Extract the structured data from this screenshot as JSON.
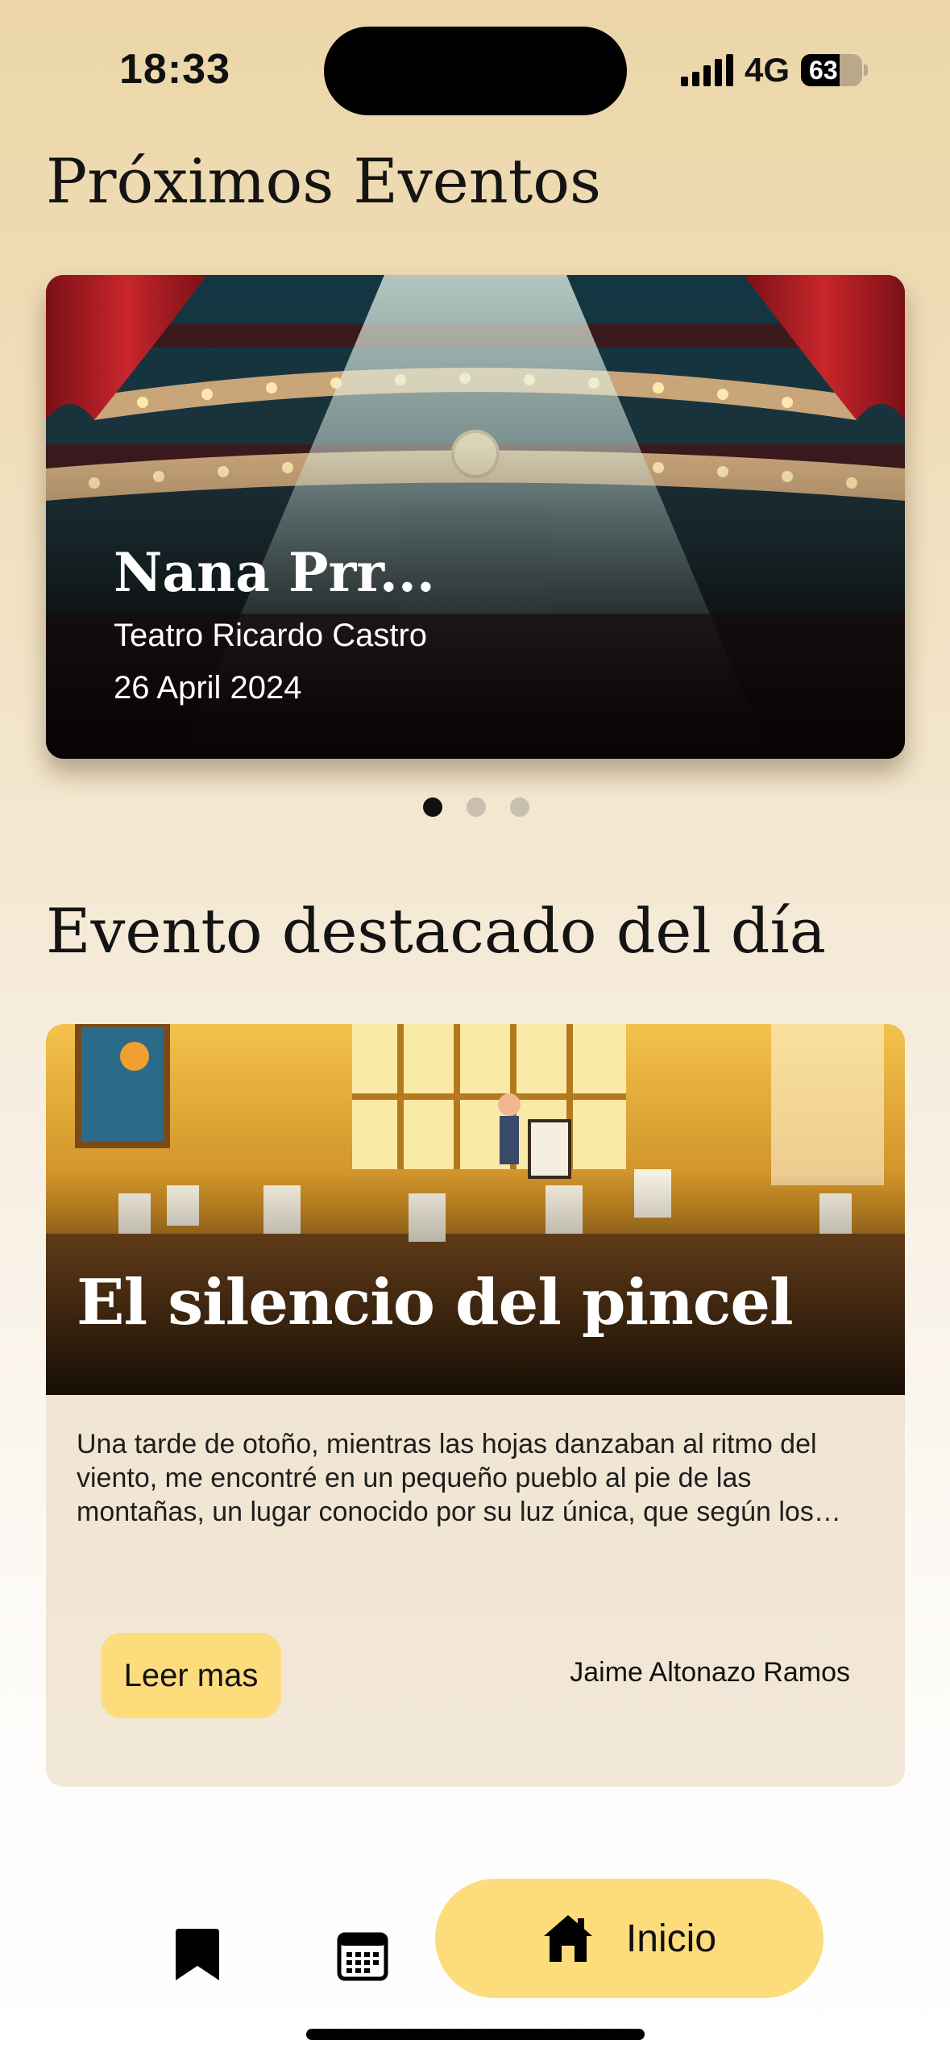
{
  "status_bar": {
    "time": "18:33",
    "network": "4G",
    "battery_level": "63",
    "battery_fraction": 0.63,
    "icons": [
      "signal-icon",
      "battery-icon"
    ]
  },
  "sections": {
    "upcoming_title": "Próximos Eventos",
    "featured_title": "Evento destacado del día"
  },
  "upcoming_carousel": {
    "event": {
      "name": "Nana Prr...",
      "venue": "Teatro Ricardo Castro",
      "date": "26 April 2024"
    },
    "page_count": 3,
    "active_index": 0
  },
  "featured": {
    "title": "El silencio del pincel",
    "excerpt": "Una tarde de otoño, mientras las hojas danzaban al ritmo del viento, me encontré en un pequeño pueblo al pie de las montañas, un lugar conocido por su luz única, que según los habitantes del lugar inspiraba a todos los pintores que lo visitaban.",
    "read_more_label": "Leer mas",
    "author": "Jaime Altonazo Ramos"
  },
  "bottom_nav": {
    "items": [
      {
        "icon": "bookmark-icon",
        "label": ""
      },
      {
        "icon": "calendar-icon",
        "label": ""
      },
      {
        "icon": "home-icon",
        "label": "Inicio",
        "active": true
      }
    ]
  },
  "colors": {
    "accent": "#fddc7c",
    "text": "#111111"
  }
}
